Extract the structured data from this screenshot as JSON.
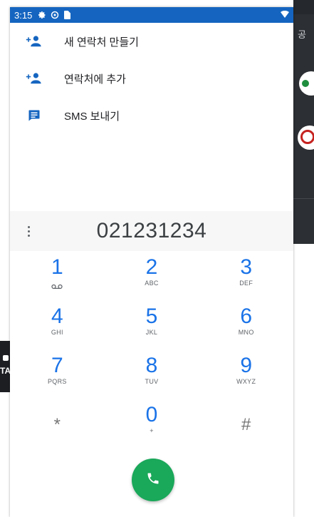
{
  "status_bar": {
    "time": "3:15",
    "icons": [
      "settings-icon",
      "sync-icon",
      "sim-icon"
    ],
    "right_icon": "wifi-icon"
  },
  "background_right": {
    "label": "공"
  },
  "background_left": {
    "label": "TA"
  },
  "actions": [
    {
      "icon": "add-person-icon",
      "label": "새 연락처 만들기"
    },
    {
      "icon": "add-person-icon",
      "label": "연락처에 추가"
    },
    {
      "icon": "message-icon",
      "label": "SMS 보내기"
    }
  ],
  "dialer": {
    "number": "021231234",
    "keys": [
      [
        {
          "digit": "1",
          "letters": "",
          "icon": "voicemail-icon"
        },
        {
          "digit": "2",
          "letters": "ABC"
        },
        {
          "digit": "3",
          "letters": "DEF"
        }
      ],
      [
        {
          "digit": "4",
          "letters": "GHI"
        },
        {
          "digit": "5",
          "letters": "JKL"
        },
        {
          "digit": "6",
          "letters": "MNO"
        }
      ],
      [
        {
          "digit": "7",
          "letters": "PQRS"
        },
        {
          "digit": "8",
          "letters": "TUV"
        },
        {
          "digit": "9",
          "letters": "WXYZ"
        }
      ],
      [
        {
          "digit": "*",
          "letters": ""
        },
        {
          "digit": "0",
          "letters": "+"
        },
        {
          "digit": "#",
          "letters": ""
        }
      ]
    ]
  },
  "colors": {
    "status_bar": "#1565c0",
    "accent": "#1a73e8",
    "call_button": "#1aa85a"
  }
}
